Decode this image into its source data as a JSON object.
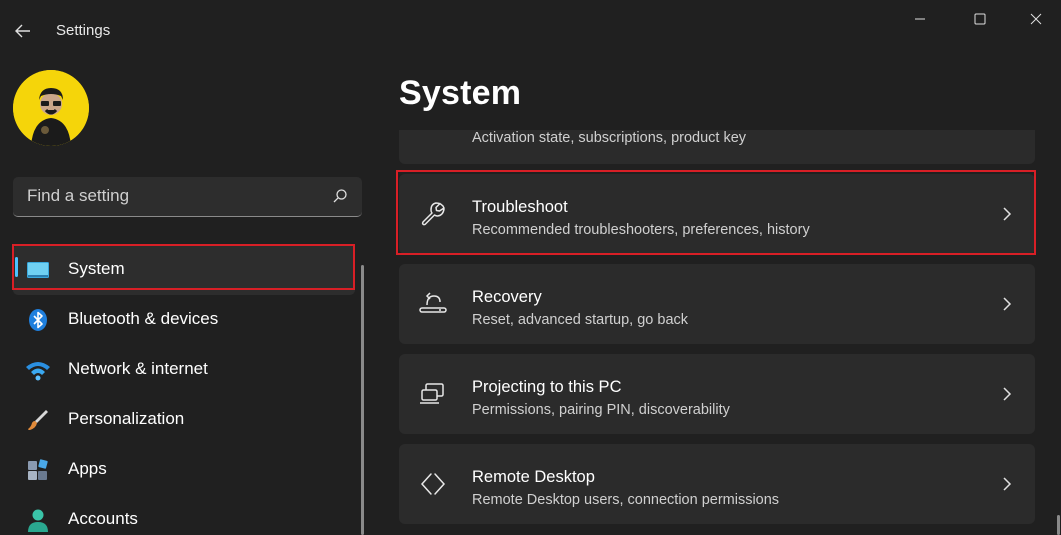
{
  "window": {
    "title": "Settings",
    "controls": [
      "minimize",
      "maximize",
      "close"
    ]
  },
  "sidebar": {
    "search": {
      "placeholder": "Find a setting",
      "value": ""
    },
    "items": [
      {
        "label": "System",
        "icon": "system-icon",
        "active": true
      },
      {
        "label": "Bluetooth & devices",
        "icon": "bluetooth-icon",
        "active": false
      },
      {
        "label": "Network & internet",
        "icon": "wifi-icon",
        "active": false
      },
      {
        "label": "Personalization",
        "icon": "brush-icon",
        "active": false
      },
      {
        "label": "Apps",
        "icon": "apps-icon",
        "active": false
      },
      {
        "label": "Accounts",
        "icon": "accounts-icon",
        "active": false
      }
    ]
  },
  "main": {
    "title": "System",
    "cards": [
      {
        "title": "",
        "subtitle": "Activation state, subscriptions, product key",
        "icon": "activation-icon"
      },
      {
        "title": "Troubleshoot",
        "subtitle": "Recommended troubleshooters, preferences, history",
        "icon": "wrench-icon"
      },
      {
        "title": "Recovery",
        "subtitle": "Reset, advanced startup, go back",
        "icon": "recovery-icon"
      },
      {
        "title": "Projecting to this PC",
        "subtitle": "Permissions, pairing PIN, discoverability",
        "icon": "projecting-icon"
      },
      {
        "title": "Remote Desktop",
        "subtitle": "Remote Desktop users, connection permissions",
        "icon": "remote-desktop-icon"
      }
    ]
  },
  "colors": {
    "background": "#202020",
    "card": "#2b2b2b",
    "accent": "#4cc2ff",
    "highlight": "#d81f26"
  }
}
